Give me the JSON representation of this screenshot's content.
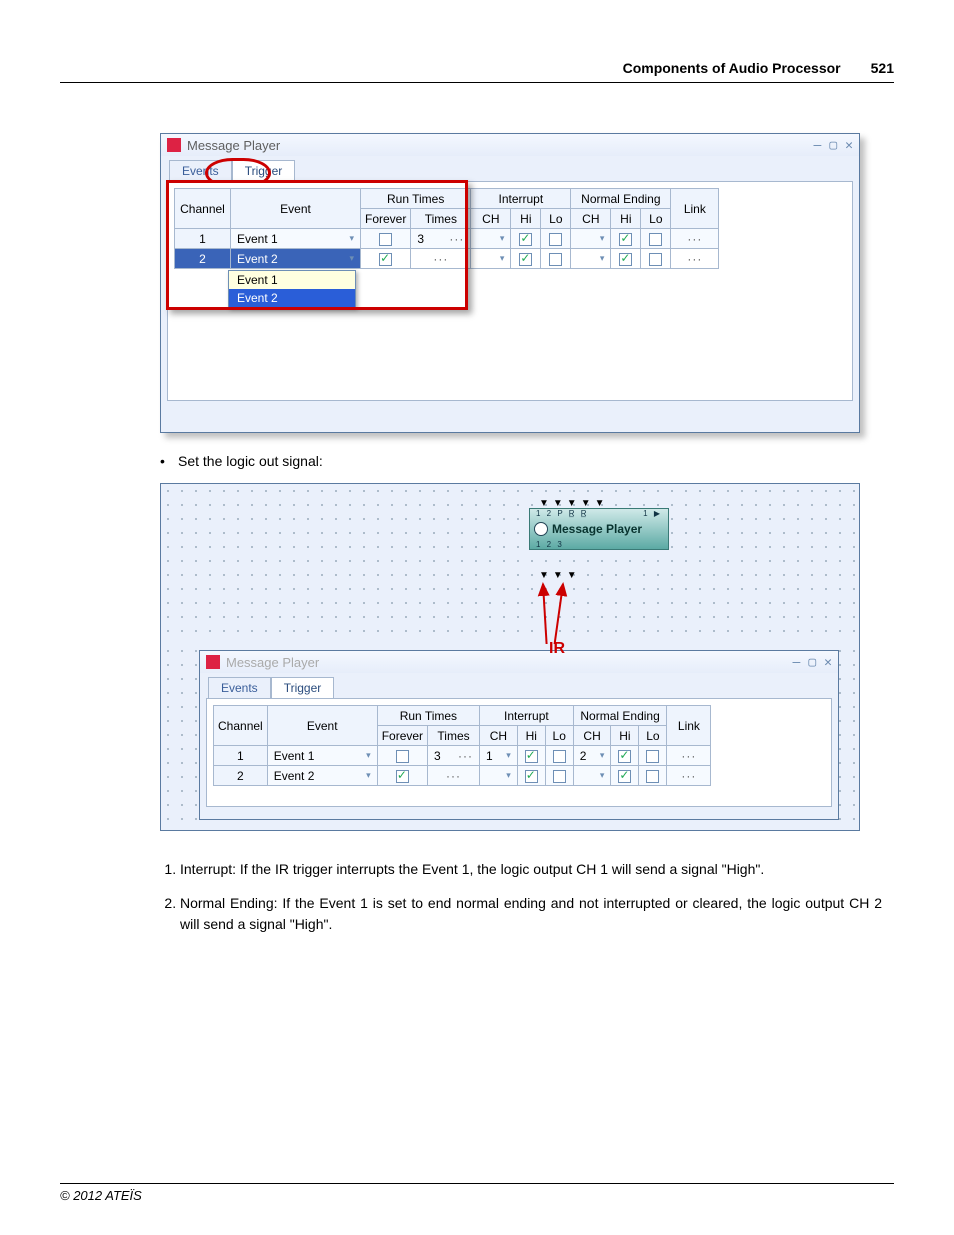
{
  "header": {
    "section": "Components of Audio Processor",
    "page": "521"
  },
  "app": {
    "title": "Message Player"
  },
  "tabs": {
    "events": "Events",
    "trigger": "Trigger"
  },
  "columns": {
    "channel": "Channel",
    "event": "Event",
    "runtimes": "Run Times",
    "forever": "Forever",
    "times": "Times",
    "interrupt": "Interrupt",
    "normal": "Normal Ending",
    "ch": "CH",
    "hi": "Hi",
    "lo": "Lo",
    "link": "Link"
  },
  "chart_data": {
    "type": "table",
    "description": "Trigger configuration table — top screenshot",
    "columns": [
      "Channel",
      "Event",
      "Forever",
      "Times",
      "Interrupt CH",
      "Interrupt Hi",
      "Interrupt Lo",
      "Normal CH",
      "Normal Hi",
      "Normal Lo",
      "Link"
    ],
    "rows": [
      {
        "channel": "1",
        "event": "Event 1",
        "forever": false,
        "times": "3",
        "int_ch": "",
        "int_hi": true,
        "int_lo": false,
        "ne_ch": "",
        "ne_hi": true,
        "ne_lo": false,
        "link": "···"
      },
      {
        "channel": "2",
        "event": "Event 2",
        "forever": true,
        "times": "···",
        "int_ch": "",
        "int_hi": true,
        "int_lo": false,
        "ne_ch": "",
        "ne_hi": true,
        "ne_lo": false,
        "link": "···"
      }
    ],
    "dropdown_options": [
      "Event 1",
      "Event 2"
    ]
  },
  "chart_data2": {
    "type": "table",
    "description": "Trigger configuration table — bottom (with IR logic-out) screenshot",
    "columns": [
      "Channel",
      "Event",
      "Forever",
      "Times",
      "Interrupt CH",
      "Interrupt Hi",
      "Interrupt Lo",
      "Normal CH",
      "Normal Hi",
      "Normal Lo",
      "Link"
    ],
    "rows": [
      {
        "channel": "1",
        "event": "Event 1",
        "forever": false,
        "times": "3",
        "int_ch": "1",
        "int_hi": true,
        "int_lo": false,
        "ne_ch": "2",
        "ne_hi": true,
        "ne_lo": false,
        "link": "···"
      },
      {
        "channel": "2",
        "event": "Event 2",
        "forever": true,
        "times": "···",
        "int_ch": "",
        "int_hi": true,
        "int_lo": false,
        "ne_ch": "",
        "ne_hi": true,
        "ne_lo": false,
        "link": "···"
      }
    ]
  },
  "component_block": {
    "label": "Message Player"
  },
  "ir_label": "IR",
  "bullet": "Set the logic out signal:",
  "list": {
    "item1": "Interrupt: If the IR trigger interrupts the Event 1, the logic output CH 1 will send a signal \"High\".",
    "item2": "Normal Ending: If the Event 1 is set to end normal ending and not interrupted or cleared, the logic output CH 2 will send a signal \"High\"."
  },
  "footer": "© 2012 ATEÏS"
}
